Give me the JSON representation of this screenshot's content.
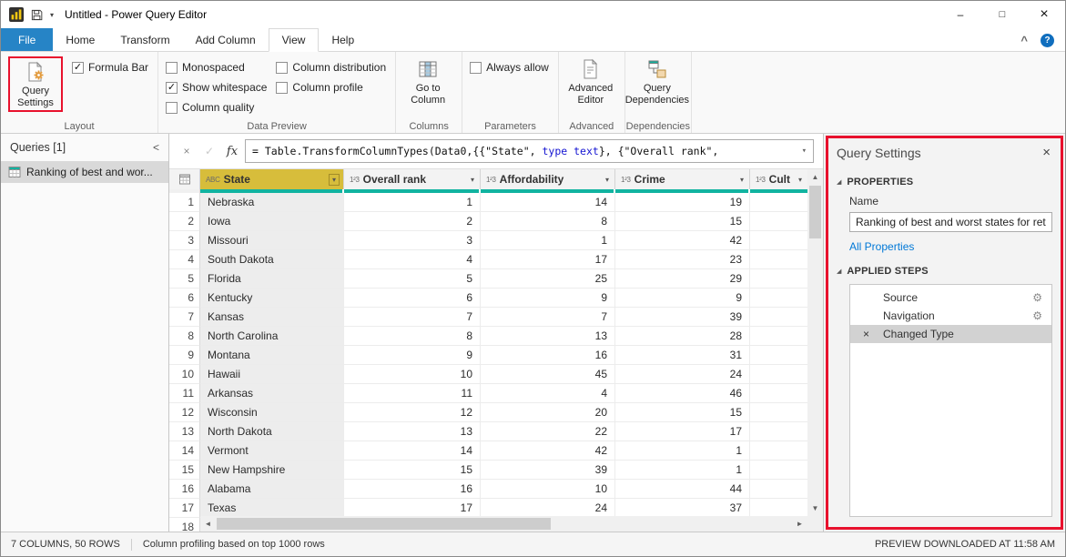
{
  "icons": {
    "gear": "⚙",
    "close": "×",
    "check": "✓",
    "chevron_down": "▾",
    "collapse_pane": "<",
    "ribbon_collapse": "^",
    "help": "?",
    "fx": "fx",
    "formula_cancel": "×",
    "formula_check": "✓",
    "quickaccess_caret": "▾",
    "minimize": "–",
    "maximize": "□",
    "window_close": "×",
    "up": "▲",
    "down": "▼",
    "left": "◄",
    "right": "►",
    "section_triangle": "◢"
  },
  "window": {
    "title": "Untitled - Power Query Editor"
  },
  "ribbon": {
    "tabs": [
      {
        "label": "File"
      },
      {
        "label": "Home"
      },
      {
        "label": "Transform"
      },
      {
        "label": "Add Column"
      },
      {
        "label": "View"
      },
      {
        "label": "Help"
      }
    ],
    "layout": {
      "group_label": "Layout",
      "query_settings_label": "Query Settings",
      "checks": [
        {
          "label": "Formula Bar",
          "checked": true
        }
      ]
    },
    "data_preview": {
      "group_label": "Data Preview",
      "col1": [
        {
          "label": "Monospaced",
          "checked": false
        },
        {
          "label": "Show whitespace",
          "checked": true
        },
        {
          "label": "Column quality",
          "checked": false
        }
      ],
      "col2": [
        {
          "label": "Column distribution",
          "checked": false
        },
        {
          "label": "Column profile",
          "checked": false
        }
      ]
    },
    "columns": {
      "group_label": "Columns",
      "button_label": "Go to Column"
    },
    "parameters": {
      "group_label": "Parameters",
      "checks": [
        {
          "label": "Always allow",
          "checked": false
        }
      ]
    },
    "advanced": {
      "group_label": "Advanced",
      "button_label": "Advanced Editor"
    },
    "dependencies": {
      "group_label": "Dependencies",
      "button_label": "Query Dependencies"
    }
  },
  "queries_pane": {
    "header": "Queries [1]",
    "items": [
      {
        "label": "Ranking of best and wor...",
        "selected": true
      }
    ]
  },
  "formula_bar": {
    "part1": "= Table.TransformColumnTypes(Data0,{{\"State\", ",
    "part2": "type text",
    "part3": "}, {\"Overall rank\","
  },
  "grid": {
    "columns": [
      {
        "icon": "ABC",
        "label": "State",
        "selected": true,
        "align": "left"
      },
      {
        "icon": "1²3",
        "label": "Overall rank",
        "selected": false,
        "align": "right"
      },
      {
        "icon": "1²3",
        "label": "Affordability",
        "selected": false,
        "align": "right"
      },
      {
        "icon": "1²3",
        "label": "Crime",
        "selected": false,
        "align": "right"
      },
      {
        "icon": "1²3",
        "label": "Cult",
        "selected": false,
        "align": "right"
      }
    ],
    "rows": [
      {
        "n": "1",
        "cells": [
          "Nebraska",
          "1",
          "14",
          "19",
          ""
        ]
      },
      {
        "n": "2",
        "cells": [
          "Iowa",
          "2",
          "8",
          "15",
          ""
        ]
      },
      {
        "n": "3",
        "cells": [
          "Missouri",
          "3",
          "1",
          "42",
          ""
        ]
      },
      {
        "n": "4",
        "cells": [
          "South Dakota",
          "4",
          "17",
          "23",
          ""
        ]
      },
      {
        "n": "5",
        "cells": [
          "Florida",
          "5",
          "25",
          "29",
          ""
        ]
      },
      {
        "n": "6",
        "cells": [
          "Kentucky",
          "6",
          "9",
          "9",
          ""
        ]
      },
      {
        "n": "7",
        "cells": [
          "Kansas",
          "7",
          "7",
          "39",
          ""
        ]
      },
      {
        "n": "8",
        "cells": [
          "North Carolina",
          "8",
          "13",
          "28",
          ""
        ]
      },
      {
        "n": "9",
        "cells": [
          "Montana",
          "9",
          "16",
          "31",
          ""
        ]
      },
      {
        "n": "10",
        "cells": [
          "Hawaii",
          "10",
          "45",
          "24",
          ""
        ]
      },
      {
        "n": "11",
        "cells": [
          "Arkansas",
          "11",
          "4",
          "46",
          ""
        ]
      },
      {
        "n": "12",
        "cells": [
          "Wisconsin",
          "12",
          "20",
          "15",
          ""
        ]
      },
      {
        "n": "13",
        "cells": [
          "North Dakota",
          "13",
          "22",
          "17",
          ""
        ]
      },
      {
        "n": "14",
        "cells": [
          "Vermont",
          "14",
          "42",
          "1",
          ""
        ]
      },
      {
        "n": "15",
        "cells": [
          "New Hampshire",
          "15",
          "39",
          "1",
          ""
        ]
      },
      {
        "n": "16",
        "cells": [
          "Alabama",
          "16",
          "10",
          "44",
          ""
        ]
      },
      {
        "n": "17",
        "cells": [
          "Texas",
          "17",
          "24",
          "37",
          ""
        ]
      },
      {
        "n": "18",
        "cells": [
          "",
          "",
          "",
          "",
          ""
        ]
      }
    ]
  },
  "query_settings": {
    "title": "Query Settings",
    "properties_header": "PROPERTIES",
    "name_label": "Name",
    "name_value": "Ranking of best and worst states for retire",
    "all_properties_link": "All Properties",
    "applied_steps_header": "APPLIED STEPS",
    "steps": [
      {
        "label": "Source",
        "gear": true,
        "selected": false
      },
      {
        "label": "Navigation",
        "gear": true,
        "selected": false
      },
      {
        "label": "Changed Type",
        "gear": false,
        "selected": true
      }
    ]
  },
  "status_bar": {
    "columns_rows": "7 COLUMNS, 50 ROWS",
    "profiling": "Column profiling based on top 1000 rows",
    "preview": "PREVIEW DOWNLOADED AT 11:58 AM"
  },
  "colors": {
    "accent_blue": "#2684c6",
    "annotation_red": "#e8112d",
    "quality_teal": "#11b3a0",
    "selected_header_gold": "#d7bd3b"
  }
}
